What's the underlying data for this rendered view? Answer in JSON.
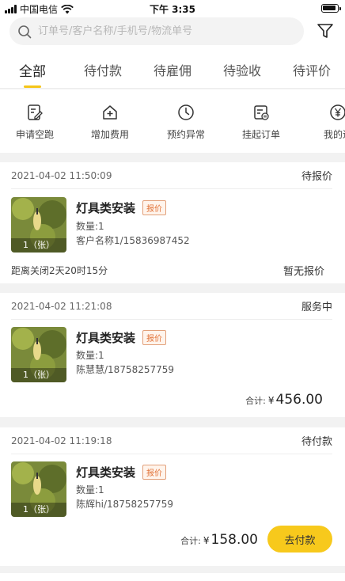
{
  "status_bar": {
    "carrier": "中国电信",
    "time": "下午 3:35"
  },
  "search": {
    "placeholder": "订单号/客户名称/手机号/物流单号"
  },
  "tabs": [
    {
      "label": "全部",
      "active": true
    },
    {
      "label": "待付款"
    },
    {
      "label": "待雇佣"
    },
    {
      "label": "待验收"
    },
    {
      "label": "待评价"
    }
  ],
  "actions": [
    {
      "label": "申请空跑",
      "icon": "edit-doc-icon"
    },
    {
      "label": "增加费用",
      "icon": "house-plus-icon"
    },
    {
      "label": "预约异常",
      "icon": "clock-icon"
    },
    {
      "label": "挂起订单",
      "icon": "doc-pause-icon"
    },
    {
      "label": "我的退",
      "icon": "yen-circle-icon"
    }
  ],
  "orders": [
    {
      "date": "2021-04-02 11:50:09",
      "status": "待报价",
      "title": "灯具类安装",
      "badge": "报价",
      "qty": "数量:1",
      "customer": "客户名称1/15836987452",
      "thumb_label": "1（张）",
      "footer_left": "距离关闭2天20时15分",
      "footer_right": "暂无报价"
    },
    {
      "date": "2021-04-02 11:21:08",
      "status": "服务中",
      "title": "灯具类安装",
      "badge": "报价",
      "qty": "数量:1",
      "customer": "陈慧慧/18758257759",
      "thumb_label": "1（张）",
      "total_label": "合计:",
      "currency": "¥",
      "total": "456.00"
    },
    {
      "date": "2021-04-02 11:19:18",
      "status": "待付款",
      "title": "灯具类安装",
      "badge": "报价",
      "qty": "数量:1",
      "customer": "陈辉hi/18758257759",
      "thumb_label": "1（张）",
      "total_label": "合计:",
      "currency": "¥",
      "total": "158.00",
      "pay_button": "去付款"
    }
  ],
  "colors": {
    "accent": "#f7c91c",
    "badge": "#e2743a"
  }
}
